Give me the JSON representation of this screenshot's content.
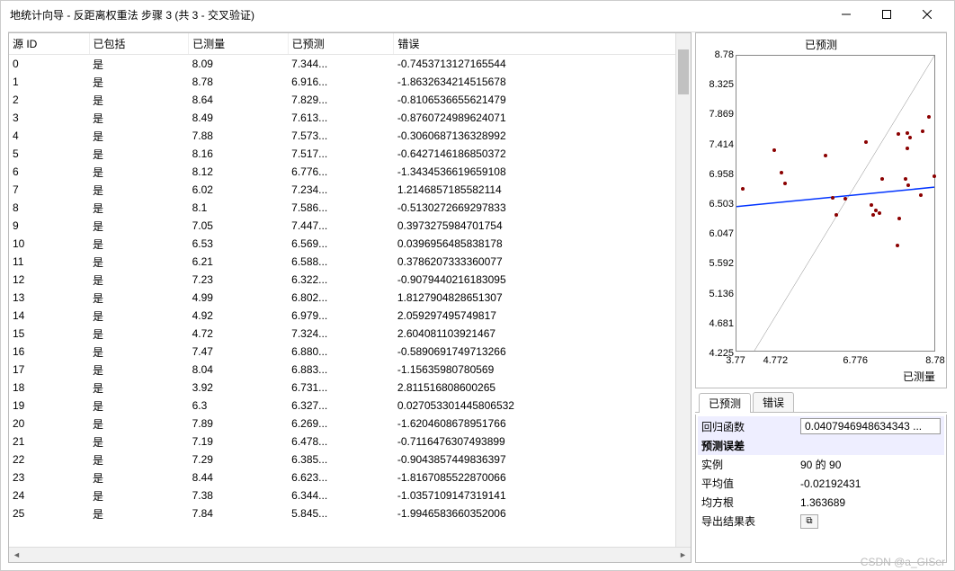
{
  "window": {
    "title": "地统计向导 - 反距离权重法 步骤 3 (共 3 - 交叉验证)"
  },
  "table": {
    "headers": [
      "源 ID",
      "已包括",
      "已测量",
      "已预测",
      "错误"
    ],
    "rows": [
      {
        "id": "0",
        "inc": "是",
        "meas": "8.09",
        "pred": "7.344...",
        "err": "-0.7453713127165544"
      },
      {
        "id": "1",
        "inc": "是",
        "meas": "8.78",
        "pred": "6.916...",
        "err": "-1.8632634214515678"
      },
      {
        "id": "2",
        "inc": "是",
        "meas": "8.64",
        "pred": "7.829...",
        "err": "-0.8106536655621479"
      },
      {
        "id": "3",
        "inc": "是",
        "meas": "8.49",
        "pred": "7.613...",
        "err": "-0.8760724989624071"
      },
      {
        "id": "4",
        "inc": "是",
        "meas": "7.88",
        "pred": "7.573...",
        "err": "-0.3060687136328992"
      },
      {
        "id": "5",
        "inc": "是",
        "meas": "8.16",
        "pred": "7.517...",
        "err": "-0.6427146186850372"
      },
      {
        "id": "6",
        "inc": "是",
        "meas": "8.12",
        "pred": "6.776...",
        "err": "-1.3434536619659108"
      },
      {
        "id": "7",
        "inc": "是",
        "meas": "6.02",
        "pred": "7.234...",
        "err": "1.2146857185582114"
      },
      {
        "id": "8",
        "inc": "是",
        "meas": "8.1",
        "pred": "7.586...",
        "err": "-0.5130272669297833"
      },
      {
        "id": "9",
        "inc": "是",
        "meas": "7.05",
        "pred": "7.447...",
        "err": "0.3973275984701754"
      },
      {
        "id": "10",
        "inc": "是",
        "meas": "6.53",
        "pred": "6.569...",
        "err": "0.0396956485838178"
      },
      {
        "id": "11",
        "inc": "是",
        "meas": "6.21",
        "pred": "6.588...",
        "err": "0.3786207333360077"
      },
      {
        "id": "12",
        "inc": "是",
        "meas": "7.23",
        "pred": "6.322...",
        "err": "-0.9079440216183095"
      },
      {
        "id": "13",
        "inc": "是",
        "meas": "4.99",
        "pred": "6.802...",
        "err": "1.8127904828651307"
      },
      {
        "id": "14",
        "inc": "是",
        "meas": "4.92",
        "pred": "6.979...",
        "err": "2.059297495749817"
      },
      {
        "id": "15",
        "inc": "是",
        "meas": "4.72",
        "pred": "7.324...",
        "err": "2.604081103921467"
      },
      {
        "id": "16",
        "inc": "是",
        "meas": "7.47",
        "pred": "6.880...",
        "err": "-0.5890691749713266"
      },
      {
        "id": "17",
        "inc": "是",
        "meas": "8.04",
        "pred": "6.883...",
        "err": "-1.15635980780569"
      },
      {
        "id": "18",
        "inc": "是",
        "meas": "3.92",
        "pred": "6.731...",
        "err": "2.811516808600265"
      },
      {
        "id": "19",
        "inc": "是",
        "meas": "6.3",
        "pred": "6.327...",
        "err": "0.027053301445806532"
      },
      {
        "id": "20",
        "inc": "是",
        "meas": "7.89",
        "pred": "6.269...",
        "err": "-1.6204608678951766"
      },
      {
        "id": "21",
        "inc": "是",
        "meas": "7.19",
        "pred": "6.478...",
        "err": "-0.7116476307493899"
      },
      {
        "id": "22",
        "inc": "是",
        "meas": "7.29",
        "pred": "6.385...",
        "err": "-0.9043857449836397"
      },
      {
        "id": "23",
        "inc": "是",
        "meas": "8.44",
        "pred": "6.623...",
        "err": "-1.8167085522870066"
      },
      {
        "id": "24",
        "inc": "是",
        "meas": "7.38",
        "pred": "6.344...",
        "err": "-1.0357109147319141"
      },
      {
        "id": "25",
        "inc": "是",
        "meas": "7.84",
        "pred": "5.845...",
        "err": "-1.9946583660352006"
      }
    ]
  },
  "chart_data": {
    "type": "scatter",
    "title": "已预测",
    "xlabel": "已测量",
    "ylabel": "",
    "xlim": [
      3.77,
      8.78
    ],
    "ylim": [
      4.225,
      8.78
    ],
    "xticks": [
      "3.77",
      "4.772",
      "6.776",
      "8.78"
    ],
    "yticks": [
      "8.78",
      "8.325",
      "7.869",
      "7.414",
      "6.958",
      "6.503",
      "6.047",
      "5.592",
      "5.136",
      "4.681",
      "4.225"
    ],
    "series": [
      {
        "name": "points",
        "x": [
          8.09,
          8.78,
          8.64,
          8.49,
          7.88,
          8.16,
          8.12,
          6.02,
          8.1,
          7.05,
          6.53,
          6.21,
          7.23,
          4.99,
          4.92,
          4.72,
          7.47,
          8.04,
          3.92,
          6.3,
          7.89,
          7.19,
          7.29,
          8.44,
          7.38,
          7.84
        ],
        "y": [
          7.344,
          6.916,
          7.829,
          7.613,
          7.573,
          7.517,
          6.776,
          7.234,
          7.586,
          7.447,
          6.569,
          6.588,
          6.322,
          6.802,
          6.979,
          7.324,
          6.88,
          6.883,
          6.731,
          6.327,
          6.269,
          6.478,
          6.385,
          6.623,
          6.344,
          5.845
        ]
      },
      {
        "name": "identity",
        "type": "line",
        "x": [
          3.77,
          8.78
        ],
        "y": [
          3.77,
          8.78
        ],
        "color": "#888"
      },
      {
        "name": "regression",
        "type": "line",
        "x": [
          3.77,
          8.78
        ],
        "y": [
          6.45,
          6.75
        ],
        "color": "#0033ff"
      }
    ]
  },
  "tabs": {
    "items": [
      "已预测",
      "错误"
    ],
    "active": 0
  },
  "stats": {
    "regression_label": "回归函数",
    "regression_value": "0.0407946948634343 ...",
    "section_header": "预测误差",
    "rows": [
      {
        "k": "实例",
        "v": "90 的 90"
      },
      {
        "k": "平均值",
        "v": "-0.02192431"
      },
      {
        "k": "均方根",
        "v": "1.363689"
      }
    ],
    "export_label": "导出结果表"
  },
  "watermark": "CSDN @a_GISer"
}
